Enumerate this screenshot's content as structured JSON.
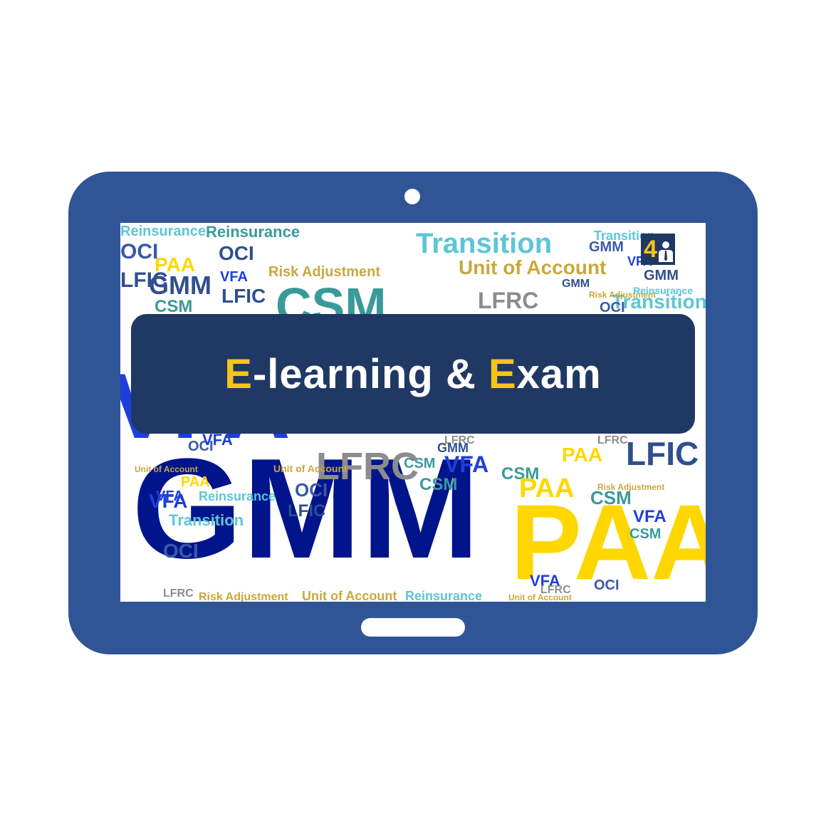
{
  "banner": {
    "title_parts": [
      {
        "text": "E",
        "accent": true
      },
      {
        "text": "-learning & ",
        "accent": false
      },
      {
        "text": "E",
        "accent": true
      },
      {
        "text": "xam",
        "accent": false
      }
    ]
  },
  "logo": {
    "digit": "4"
  },
  "word_cloud_terms": [
    "GMM",
    "PAA",
    "VFA",
    "CSM",
    "LFRC",
    "LFIC",
    "OCI",
    "Transition",
    "Reinsurance",
    "Risk Adjustment",
    "Unit of Account"
  ],
  "colors": {
    "tablet_body": "#2f5597",
    "banner_bg": "#203864",
    "accent": "#f5c518",
    "palette": [
      "#00148c",
      "#ffd700",
      "#1f3fdc",
      "#3a9a9a",
      "#8c8c8c",
      "#2f4f8f",
      "#5cc6d6",
      "#c8a83c",
      "#3a5aa8"
    ]
  }
}
